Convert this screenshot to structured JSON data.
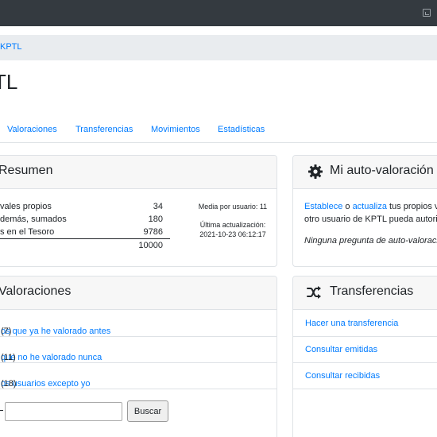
{
  "breadcrumb": {
    "label": "KPTL"
  },
  "page_title": "TL",
  "tabs": [
    "Valoraciones",
    "Transferencias",
    "Movimientos",
    "Estadísticas"
  ],
  "resumen": {
    "title": "Resumen",
    "rows": [
      {
        "label": "vales propios",
        "value": "34"
      },
      {
        "label": "demás, sumados",
        "value": "180"
      },
      {
        "label": "s en el Tesoro",
        "value": "9786"
      }
    ],
    "total": "10000",
    "media": "Media por usuario: 11",
    "ultima_label": "Última actualización:",
    "ultima_value": "2021-10-23 06:12:17"
  },
  "auto": {
    "title": "Mi auto-valoración",
    "link1": "Establece",
    "sep": "o",
    "link2": "actualiza",
    "text1": "tus propios v",
    "text2": "otro usuario de KPTL pueda autori",
    "note": "Ninguna pregunta de auto-valoraci"
  },
  "valoraciones": {
    "title": "Valoraciones",
    "items": [
      {
        "link": "os que ya he valorado antes",
        "count": "(7)"
      },
      {
        "link": "que no he valorado nunca",
        "count": "(11)"
      },
      {
        "link": "os usuarios excepto yo",
        "count": "(18)"
      }
    ],
    "search_button": "Buscar",
    "search_value": ""
  },
  "transferencias": {
    "title": "Transferencias",
    "items": [
      "Hacer una transferencia",
      "Consultar emitidas",
      "Consultar recibidas"
    ]
  },
  "colors": {
    "link": "#007bff",
    "topbar": "#343a40",
    "header_bg": "#f7f7f7"
  }
}
